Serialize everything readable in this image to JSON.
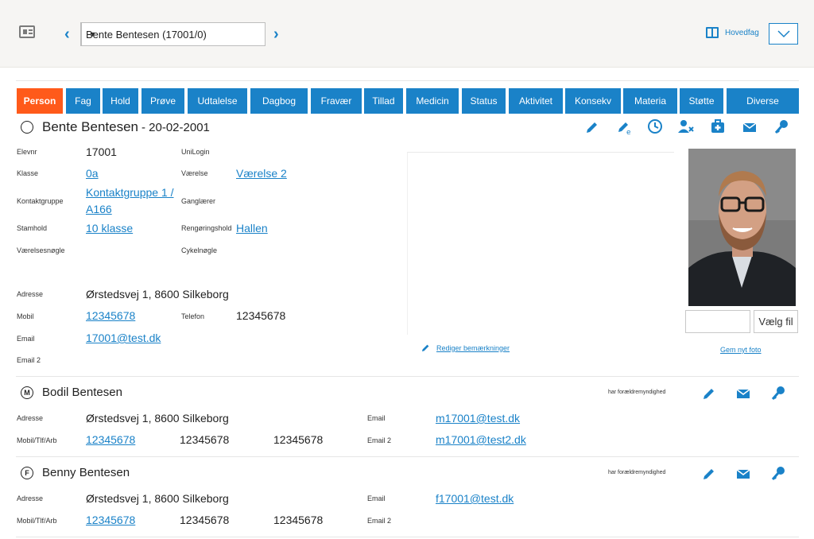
{
  "header": {
    "student_select_value": "Bente Bentesen (17001/0)",
    "prev_arrow": "‹",
    "next_arrow": "›",
    "hovedfag_label": "Hovedfag"
  },
  "tabs": [
    {
      "label": "Person",
      "active": true
    },
    {
      "label": "Fag"
    },
    {
      "label": "Hold"
    },
    {
      "label": "Prøve"
    },
    {
      "label": "Udtalelse"
    },
    {
      "label": "Dagbog"
    },
    {
      "label": "Fravær"
    },
    {
      "label": "Tillad"
    },
    {
      "label": "Medicin"
    },
    {
      "label": "Status"
    },
    {
      "label": "Aktivitet"
    },
    {
      "label": "Konsekv"
    },
    {
      "label": "Materia"
    },
    {
      "label": "Støtte"
    },
    {
      "label": "Diverse"
    }
  ],
  "student": {
    "title": "Bente Bentesen",
    "birthdate": "- 20-02-2001",
    "fields": {
      "elevnr_label": "Elevnr",
      "elevnr": "17001",
      "unilogin_label": "UniLogin",
      "klasse_label": "Klasse",
      "klasse": "0a",
      "vaerelse_label": "Værelse",
      "vaerelse": "Værelse 2",
      "kontaktgruppe_label": "Kontaktgruppe",
      "kontaktgruppe_line1": "Kontaktgruppe 1 /",
      "kontaktgruppe_line2": "A166",
      "ganglaerer_label": "Ganglærer",
      "stamhold_label": "Stamhold",
      "stamhold": "10 klasse",
      "rengoeringshold_label": "Rengøringshold",
      "rengoeringshold": "Hallen",
      "vaerelsesnoegle_label": "Værelsesnøgle",
      "cykelnoegle_label": "Cykelnøgle",
      "adresse_label": "Adresse",
      "adresse": "Ørstedsvej 1, 8600 Silkeborg",
      "mobil_label": "Mobil",
      "mobil": "12345678",
      "telefon_label": "Telefon",
      "telefon": "12345678",
      "email_label": "Email",
      "email": "17001@test.dk",
      "email2_label": "Email 2"
    },
    "edit_notes_label": "Rediger bemærkninger",
    "file_button_label": "Vælg fil",
    "save_photo_label": "Gem nyt foto"
  },
  "mother": {
    "badge": "M",
    "name": "Bodil Bentesen",
    "custody_label": "har forældremyndighed",
    "adresse_label": "Adresse",
    "adresse": "Ørstedsvej 1, 8600 Silkeborg",
    "phones_label": "Mobil/Tlf/Arb",
    "mobil": "12345678",
    "tlf": "12345678",
    "arb": "12345678",
    "email_label": "Email",
    "email": "m17001@test.dk",
    "email2_label": "Email 2",
    "email2": "m17001@test2.dk"
  },
  "father": {
    "badge": "F",
    "name": "Benny Bentesen",
    "custody_label": "har forældremyndighed",
    "adresse_label": "Adresse",
    "adresse": "Ørstedsvej 1, 8600 Silkeborg",
    "phones_label": "Mobil/Tlf/Arb",
    "mobil": "12345678",
    "tlf": "12345678",
    "arb": "12345678",
    "email_label": "Email",
    "email": "f17001@test.dk",
    "email2_label": "Email 2"
  },
  "colors": {
    "accent": "#1a82c8",
    "active_tab": "#ff5a1a"
  }
}
